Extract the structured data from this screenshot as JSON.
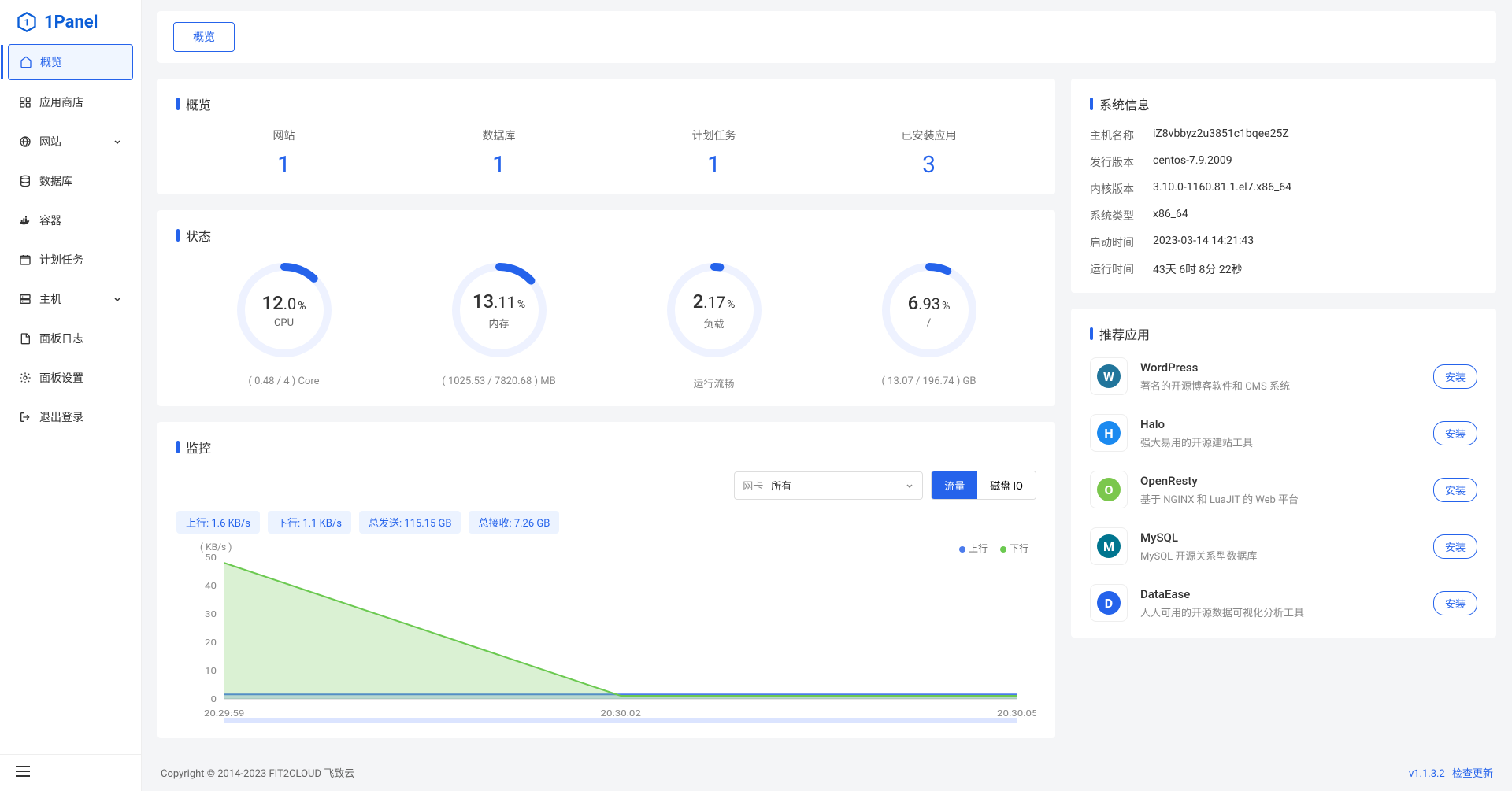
{
  "brand": "1Panel",
  "nav": [
    {
      "id": "overview",
      "label": "概览",
      "icon": "home",
      "active": true
    },
    {
      "id": "appstore",
      "label": "应用商店",
      "icon": "apps"
    },
    {
      "id": "website",
      "label": "网站",
      "icon": "globe",
      "chevron": true
    },
    {
      "id": "database",
      "label": "数据库",
      "icon": "database"
    },
    {
      "id": "container",
      "label": "容器",
      "icon": "docker"
    },
    {
      "id": "cron",
      "label": "计划任务",
      "icon": "calendar"
    },
    {
      "id": "host",
      "label": "主机",
      "icon": "server",
      "chevron": true
    },
    {
      "id": "log",
      "label": "面板日志",
      "icon": "file"
    },
    {
      "id": "setting",
      "label": "面板设置",
      "icon": "gear"
    },
    {
      "id": "logout",
      "label": "退出登录",
      "icon": "logout"
    }
  ],
  "tab": "概览",
  "overview": {
    "title": "概览",
    "stats": [
      {
        "label": "网站",
        "value": "1"
      },
      {
        "label": "数据库",
        "value": "1"
      },
      {
        "label": "计划任务",
        "value": "1"
      },
      {
        "label": "已安装应用",
        "value": "3"
      }
    ]
  },
  "status": {
    "title": "状态",
    "gauges": [
      {
        "big": "12",
        "rest": ".0",
        "pct": "%",
        "name": "CPU",
        "sub": "( 0.48 / 4 ) Core",
        "percent": 12.0
      },
      {
        "big": "13",
        "rest": ".11",
        "pct": "%",
        "name": "内存",
        "sub": "( 1025.53 / 7820.68 ) MB",
        "percent": 13.11
      },
      {
        "big": "2",
        "rest": ".17",
        "pct": "%",
        "name": "负载",
        "sub": "运行流畅",
        "percent": 2.17
      },
      {
        "big": "6",
        "rest": ".93",
        "pct": "%",
        "name": "/",
        "sub": "( 13.07 / 196.74 ) GB",
        "percent": 6.93
      }
    ]
  },
  "monitor": {
    "title": "监控",
    "netLabel": "网卡",
    "netValue": "所有",
    "btnTraffic": "流量",
    "btnDisk": "磁盘 IO",
    "tags": [
      "上行: 1.6 KB/s",
      "下行: 1.1 KB/s",
      "总发送: 115.15 GB",
      "总接收: 7.26 GB"
    ],
    "legendUp": "上行",
    "legendDown": "下行",
    "yUnit": "( KB/s )"
  },
  "chart_data": {
    "type": "area",
    "ylabel": "KB/s",
    "ylim": [
      0,
      50
    ],
    "yticks": [
      0,
      10,
      20,
      30,
      40,
      50
    ],
    "x": [
      "20:29:59",
      "20:30:02",
      "20:30:05"
    ],
    "series": [
      {
        "name": "上行",
        "color": "#4b7bec",
        "values": [
          1.6,
          1.6,
          1.6
        ]
      },
      {
        "name": "下行",
        "color": "#6bc950",
        "values": [
          48,
          1.1,
          1.1
        ]
      }
    ]
  },
  "sysinfo": {
    "title": "系统信息",
    "rows": [
      {
        "k": "主机名称",
        "v": "iZ8vbbyz2u3851c1bqee25Z"
      },
      {
        "k": "发行版本",
        "v": "centos-7.9.2009"
      },
      {
        "k": "内核版本",
        "v": "3.10.0-1160.81.1.el7.x86_64"
      },
      {
        "k": "系统类型",
        "v": "x86_64"
      },
      {
        "k": "启动时间",
        "v": "2023-03-14 14:21:43"
      },
      {
        "k": "运行时间",
        "v": "43天 6时 8分 22秒"
      }
    ]
  },
  "recommended": {
    "title": "推荐应用",
    "install": "安装",
    "apps": [
      {
        "id": "wordpress",
        "name": "WordPress",
        "desc": "著名的开源博客软件和 CMS 系统",
        "color": "#21759b",
        "letter": "W"
      },
      {
        "id": "halo",
        "name": "Halo",
        "desc": "强大易用的开源建站工具",
        "color": "#1b8af0",
        "letter": "H"
      },
      {
        "id": "openresty",
        "name": "OpenResty",
        "desc": "基于 NGINX 和 LuaJIT 的 Web 平台",
        "color": "#7BC74D",
        "letter": "O"
      },
      {
        "id": "mysql",
        "name": "MySQL",
        "desc": "MySQL 开源关系型数据库",
        "color": "#00758f",
        "letter": "M"
      },
      {
        "id": "dataease",
        "name": "DataEase",
        "desc": "人人可用的开源数据可视化分析工具",
        "color": "#2563eb",
        "letter": "D"
      }
    ]
  },
  "footer": {
    "copyright": "Copyright © 2014-2023 FIT2CLOUD 飞致云",
    "version": "v1.1.3.2",
    "check": "检查更新"
  }
}
